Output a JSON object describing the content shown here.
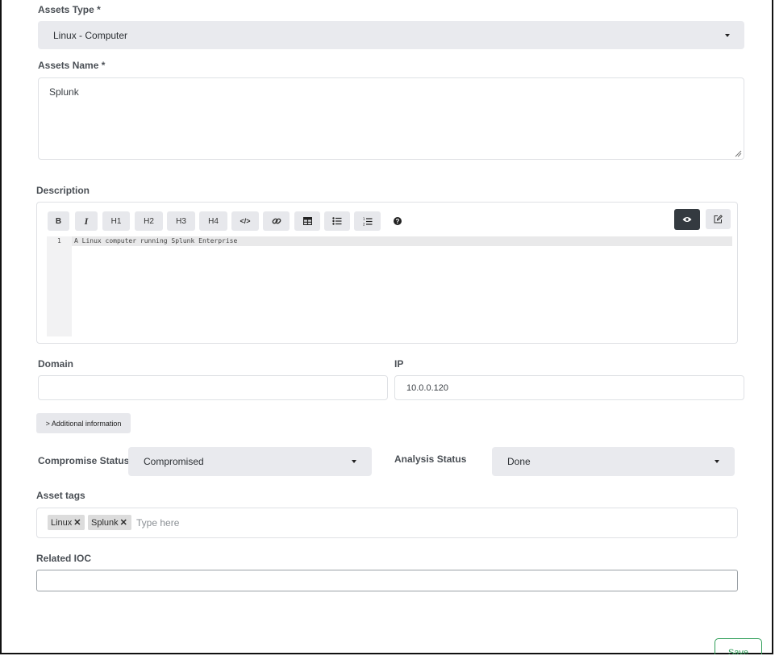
{
  "assets_type": {
    "label": "Assets Type *",
    "value": "Linux - Computer"
  },
  "assets_name": {
    "label": "Assets Name *",
    "value": "Splunk"
  },
  "description": {
    "label": "Description",
    "toolbar": [
      "B",
      "I",
      "H1",
      "H2",
      "H3",
      "H4",
      "</>",
      "link",
      "table",
      "ul",
      "ol",
      "?"
    ],
    "line_number": "1",
    "content": "A Linux computer running Splunk Enterprise"
  },
  "domain": {
    "label": "Domain",
    "value": ""
  },
  "ip": {
    "label": "IP",
    "value": "10.0.0.120"
  },
  "additional_info_button": "> Additional information",
  "compromise_status": {
    "label": "Compromise Status",
    "value": "Compromised"
  },
  "analysis_status": {
    "label": "Analysis Status",
    "value": "Done"
  },
  "asset_tags": {
    "label": "Asset tags",
    "tags": [
      "Linux",
      "Splunk"
    ],
    "placeholder": "Type here"
  },
  "related_ioc": {
    "label": "Related IOC",
    "value": ""
  },
  "save_button": "Save",
  "colors": {
    "accent_green": "#2e9e57",
    "input_bg": "#e9eaee",
    "dark_button": "#343a40"
  }
}
